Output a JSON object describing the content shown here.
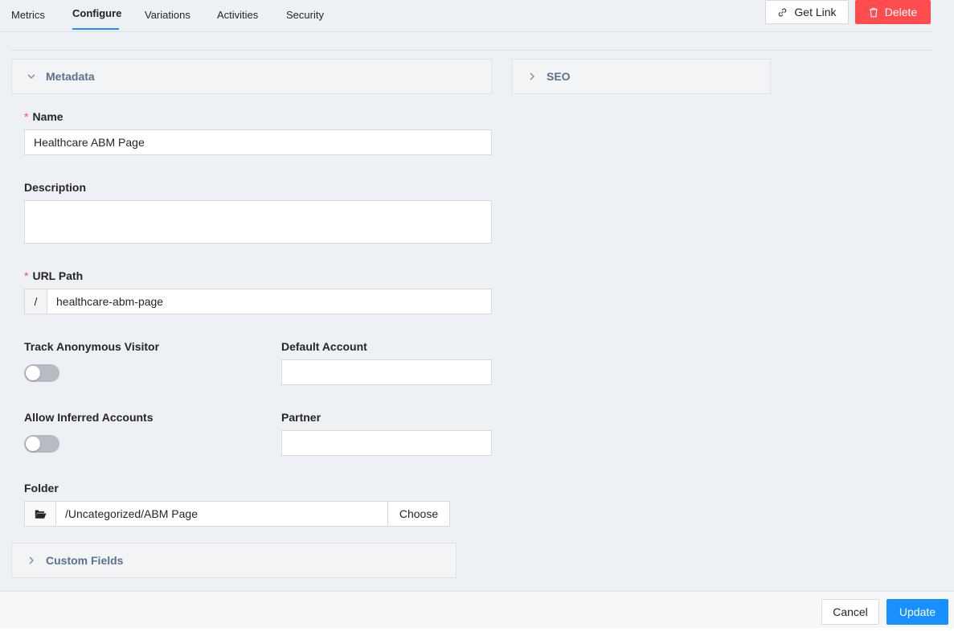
{
  "tabs": [
    {
      "label": "Metrics",
      "active": false
    },
    {
      "label": "Configure",
      "active": true
    },
    {
      "label": "Variations",
      "active": false
    },
    {
      "label": "Activities",
      "active": false
    },
    {
      "label": "Security",
      "active": false
    }
  ],
  "header_actions": {
    "get_link_label": "Get Link",
    "delete_label": "Delete"
  },
  "panels": {
    "metadata": "Metadata",
    "seo": "SEO",
    "custom_fields": "Custom Fields"
  },
  "form": {
    "name_label": "Name",
    "name_value": "Healthcare ABM Page",
    "description_label": "Description",
    "description_value": "",
    "url_path_label": "URL Path",
    "url_prefix": "/",
    "url_path_value": "healthcare-abm-page",
    "track_anonymous_label": "Track Anonymous Visitor",
    "track_anonymous_on": false,
    "default_account_label": "Default Account",
    "default_account_value": "",
    "allow_inferred_label": "Allow Inferred Accounts",
    "allow_inferred_on": false,
    "partner_label": "Partner",
    "partner_value": "",
    "folder_label": "Folder",
    "folder_value": "/Uncategorized/ABM Page",
    "choose_label": "Choose",
    "required_mark": "*"
  },
  "footer": {
    "cancel_label": "Cancel",
    "update_label": "Update"
  },
  "colors": {
    "primary": "#1890ff",
    "danger": "#ff4d4f",
    "panel_header_text": "#5a7290"
  }
}
